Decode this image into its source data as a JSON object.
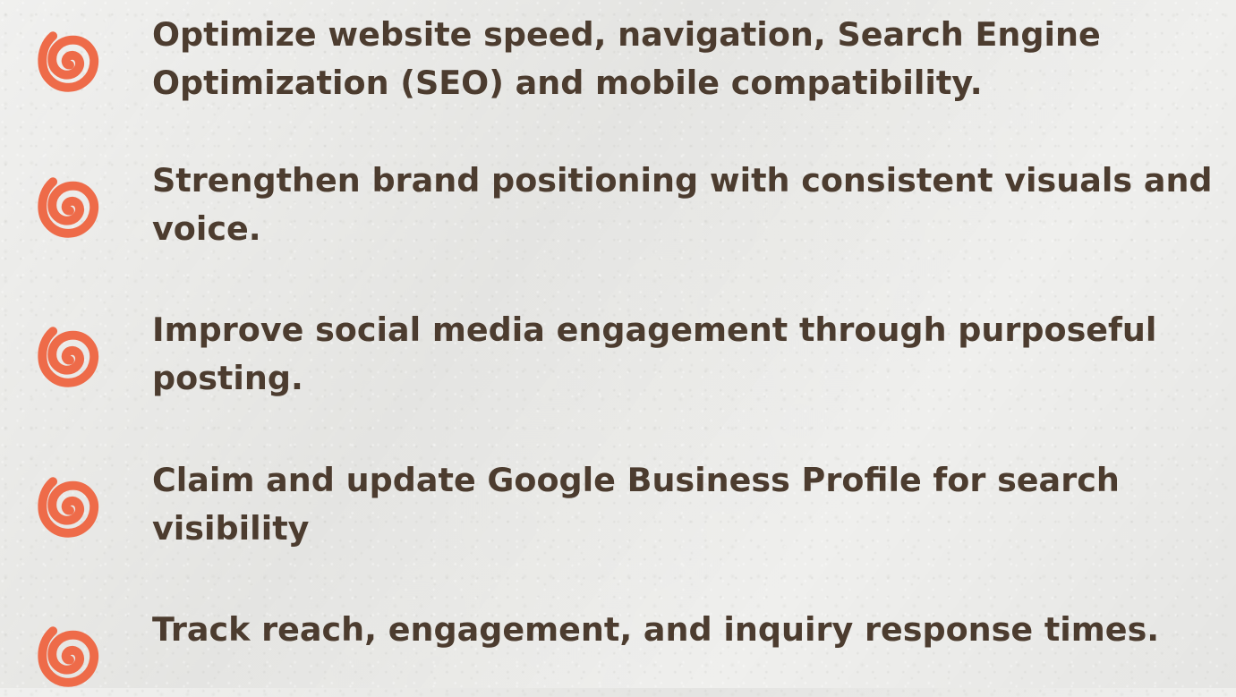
{
  "accent_color": "#ee6b49",
  "text_color": "#4c3c2f",
  "bullet_icon": "spiral-icon",
  "items": [
    {
      "text": "Optimize website speed, navigation, Search Engine Optimization (SEO) and mobile compatibility."
    },
    {
      "text": "Strengthen brand positioning with consistent visuals and voice."
    },
    {
      "text": "Improve social media engagement through purposeful posting."
    },
    {
      "text": "Claim and update Google Business Profile for search visibility"
    },
    {
      "text": "Track reach, engagement, and inquiry response times."
    }
  ]
}
